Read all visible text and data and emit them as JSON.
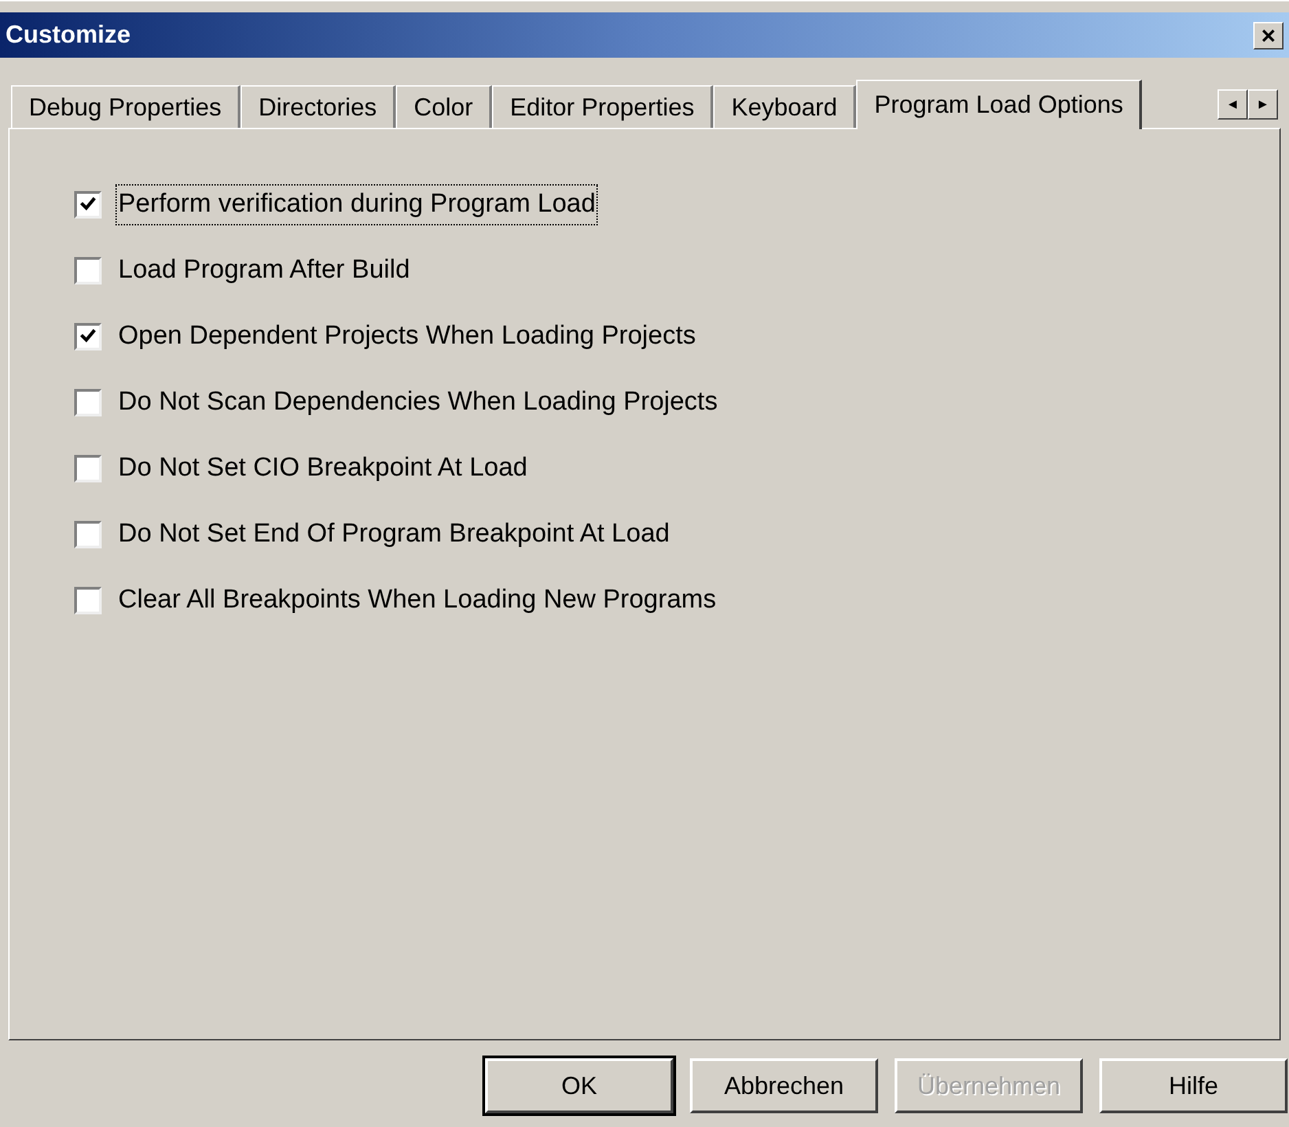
{
  "window": {
    "title": "Customize",
    "close": "×"
  },
  "tabs": [
    {
      "label": "Debug Properties",
      "selected": false
    },
    {
      "label": "Directories",
      "selected": false
    },
    {
      "label": "Color",
      "selected": false
    },
    {
      "label": "Editor Properties",
      "selected": false
    },
    {
      "label": "Keyboard",
      "selected": false
    },
    {
      "label": "Program Load Options",
      "selected": true
    }
  ],
  "tab_scroll": [
    "◄",
    "►"
  ],
  "options": [
    {
      "label": "Perform verification during Program Load",
      "checked": true,
      "focused": true
    },
    {
      "label": "Load Program After Build",
      "checked": false,
      "focused": false
    },
    {
      "label": "Open Dependent Projects When Loading Projects",
      "checked": true,
      "focused": false
    },
    {
      "label": "Do Not Scan Dependencies When Loading Projects",
      "checked": false,
      "focused": false
    },
    {
      "label": "Do Not Set CIO Breakpoint At Load",
      "checked": false,
      "focused": false
    },
    {
      "label": "Do Not Set End Of Program Breakpoint At Load",
      "checked": false,
      "focused": false
    },
    {
      "label": "Clear All Breakpoints When Loading New Programs",
      "checked": false,
      "focused": false
    }
  ],
  "buttons": [
    {
      "label": "OK",
      "default": true,
      "disabled": false
    },
    {
      "label": "Abbrechen",
      "default": false,
      "disabled": false
    },
    {
      "label": "Übernehmen",
      "default": false,
      "disabled": true
    },
    {
      "label": "Hilfe",
      "default": false,
      "disabled": false
    }
  ]
}
